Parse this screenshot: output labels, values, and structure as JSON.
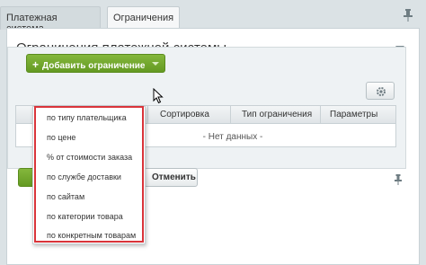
{
  "tabs": [
    {
      "label": "Платежная система"
    },
    {
      "label": "Ограничения"
    }
  ],
  "panel": {
    "title": "Ограничения платежной системы"
  },
  "toolbar": {
    "add_button_label": "Добавить ограничение",
    "add_button_plus": "+"
  },
  "grid": {
    "columns": [
      "Сортировка",
      "Тип ограничения",
      "Параметры"
    ],
    "empty_text": "- Нет данных -"
  },
  "dropdown": {
    "items": [
      "по типу плательщика",
      "по цене",
      "% от стоимости заказа",
      "по службе доставки",
      "по сайтам",
      "по категории товара",
      "по конкретным товарам"
    ]
  },
  "actions": {
    "cancel_label": "Отменить"
  },
  "colors": {
    "accent_green": "#6ba52a",
    "highlight_red": "#d9343a",
    "background": "#dbe2e5"
  },
  "icons": {
    "pin": "pin-icon",
    "gear": "gear-icon",
    "collapse": "chevron-down-icon",
    "cursor": "mouse-cursor-icon"
  }
}
